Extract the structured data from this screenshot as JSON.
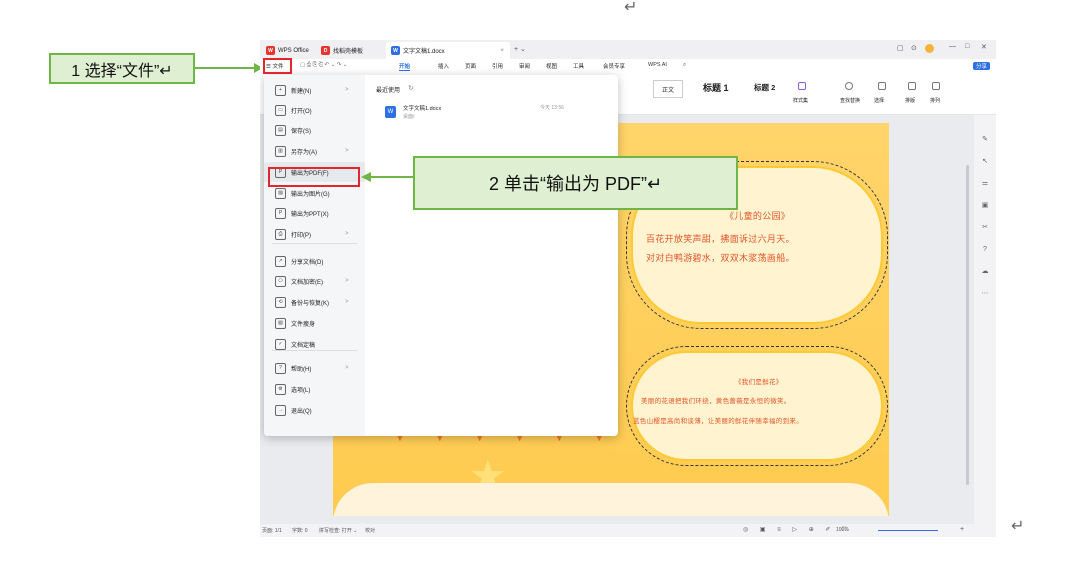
{
  "top_return_mark": "↵",
  "bottom_return_mark": "↵",
  "tabs": [
    {
      "label": "WPS Office",
      "logo": "W",
      "color": "#e5352d"
    },
    {
      "label": "找稻壳模板",
      "logo": "D",
      "color": "#e5352d"
    },
    {
      "label": "文字文稿1.docx",
      "logo": "W",
      "color": "#2f6fe4"
    }
  ],
  "tab_close": "×",
  "tab_new": "+ ⌄",
  "window_controls": [
    "▢",
    "⊙",
    "—",
    "□",
    "✕"
  ],
  "menubar": {
    "file_label": "☰ 文件",
    "items": [
      "开始",
      "插入",
      "页面",
      "引用",
      "审阅",
      "视图",
      "工具",
      "会员专享"
    ],
    "active": "开始",
    "ai_label": "WPS AI",
    "share_label": "分享"
  },
  "ribbon": {
    "styles": [
      "正文",
      "标题 1",
      "标题 2"
    ],
    "tools": [
      "样式集",
      "查找替换",
      "选择",
      "排版",
      "排列"
    ]
  },
  "file_menu": {
    "items": [
      {
        "label": "新建(N)",
        "icon": "new-doc-icon",
        "arrow": ">"
      },
      {
        "label": "打开(O)",
        "icon": "folder-icon",
        "arrow": ""
      },
      {
        "label": "保存(S)",
        "icon": "save-icon",
        "arrow": ""
      },
      {
        "label": "另存为(A)",
        "icon": "save-as-icon",
        "arrow": ">"
      },
      {
        "label": "输出为PDF(F)",
        "icon": "pdf-icon",
        "arrow": ""
      },
      {
        "label": "输出为图片(G)",
        "icon": "image-icon",
        "arrow": ""
      },
      {
        "label": "输出为PPT(X)",
        "icon": "ppt-icon",
        "arrow": ""
      },
      {
        "label": "打印(P)",
        "icon": "print-icon",
        "arrow": ">"
      },
      {
        "label": "分享文档(D)",
        "icon": "share-icon",
        "arrow": ""
      },
      {
        "label": "文档加密(E)",
        "icon": "lock-icon",
        "arrow": ">"
      },
      {
        "label": "备份与恢复(K)",
        "icon": "backup-icon",
        "arrow": ">"
      },
      {
        "label": "文件瘦身",
        "icon": "slim-icon",
        "arrow": ""
      },
      {
        "label": "文档定稿",
        "icon": "final-icon",
        "arrow": ""
      },
      {
        "label": "帮助(H)",
        "icon": "help-icon",
        "arrow": ">"
      },
      {
        "label": "选项(L)",
        "icon": "gear-icon",
        "arrow": ""
      },
      {
        "label": "退出(Q)",
        "icon": "exit-icon",
        "arrow": ""
      }
    ],
    "recent_title": "最近使用",
    "recent_files": [
      {
        "name": "文字文稿1.docx",
        "location": "桌面/",
        "time": "今天 13:56"
      }
    ]
  },
  "document": {
    "poem1_title": "《儿童的公园》",
    "poem1_lines": [
      "百花开放笑声甜，拂面诉过六月天。",
      "对对白鸭游碧水，双双木浆荡画船。"
    ],
    "poem2_title": "《我们是鲜花》",
    "poem2_lines": [
      "美丽的花语把我们环绕，黄色蔷薇是永恒的微笑。",
      "蓝色山樱是高尚和谈薄，让美丽的鲜花伴随幸福的到来。"
    ]
  },
  "statusbar": {
    "page": "页面: 1/1",
    "words": "字数: 0",
    "spell": "拼写检查: 打开 ⌄",
    "proof": "校对",
    "zoom": "100%"
  },
  "callouts": {
    "step1": "1 选择“文件”↵",
    "step2": "2 单击“输出为 PDF”↵"
  },
  "colors": {
    "callout_bg": "#dff0d2",
    "callout_border": "#6fb547",
    "highlight": "#e3262b",
    "accent": "#2f6fe4"
  }
}
